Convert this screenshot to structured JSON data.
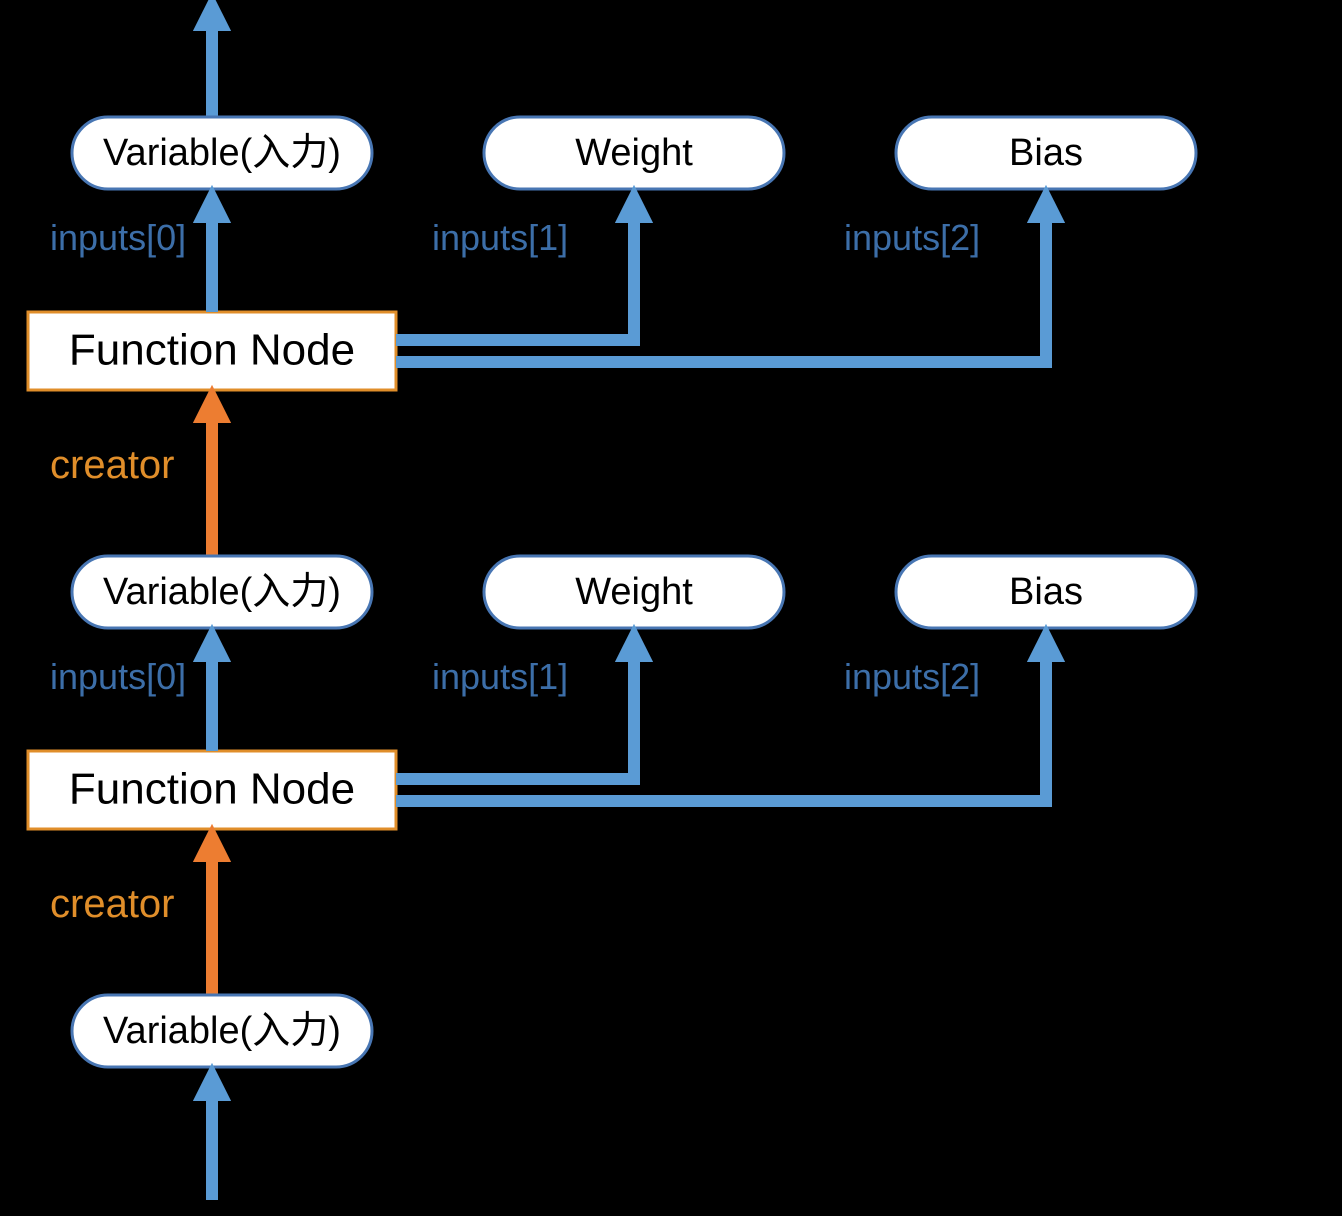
{
  "colors": {
    "blue": "#5a9bd5",
    "orange": "#ed7d31",
    "blueText": "#3c6ea8",
    "orangeText": "#e08e2a"
  },
  "upper": {
    "funcLabel": "Function Node",
    "variable": "Variable(入力)",
    "weight": "Weight",
    "bias": "Bias",
    "inputs": [
      "inputs[0]",
      "inputs[1]",
      "inputs[2]"
    ],
    "creator": "creator"
  },
  "lower": {
    "funcLabel": "Function Node",
    "variable": "Variable(入力)",
    "weight": "Weight",
    "bias": "Bias",
    "inputs": [
      "inputs[0]",
      "inputs[1]",
      "inputs[2]"
    ],
    "creator": "creator"
  },
  "bottom": {
    "variable": "Variable(入力)"
  }
}
